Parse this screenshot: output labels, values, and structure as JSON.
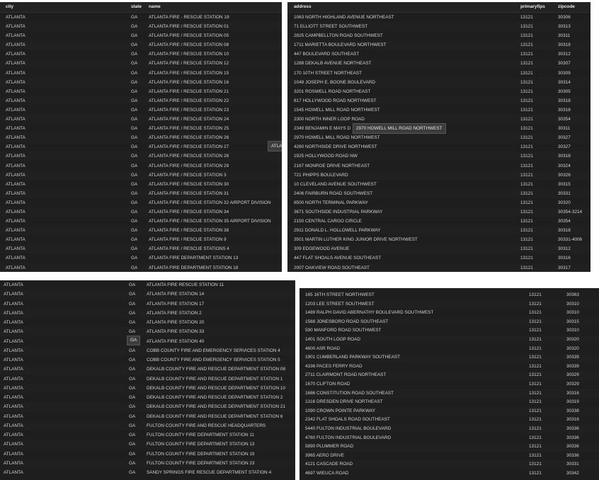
{
  "panel1": {
    "headers": {
      "city": "city",
      "state": "state",
      "name": "name"
    },
    "rows": [
      [
        "ATLANTA",
        "GA",
        "ATLANTA FIRE - RESCUE STATION 19"
      ],
      [
        "ATLANTA",
        "GA",
        "ATLANTA FIRE / RESCUE STATION 01"
      ],
      [
        "ATLANTA",
        "GA",
        "ATLANTA FIRE / RESCUE STATION 05"
      ],
      [
        "ATLANTA",
        "GA",
        "ATLANTA FIRE / RESCUE STATION 08"
      ],
      [
        "ATLANTA",
        "GA",
        "ATLANTA FIRE / RESCUE STATION 10"
      ],
      [
        "ATLANTA",
        "GA",
        "ATLANTA FIRE / RESCUE STATION 12"
      ],
      [
        "ATLANTA",
        "GA",
        "ATLANTA FIRE / RESCUE STATION 15"
      ],
      [
        "ATLANTA",
        "GA",
        "ATLANTA FIRE / RESCUE STATION 16"
      ],
      [
        "ATLANTA",
        "GA",
        "ATLANTA FIRE / RESCUE STATION 21"
      ],
      [
        "ATLANTA",
        "GA",
        "ATLANTA FIRE / RESCUE STATION 22"
      ],
      [
        "ATLANTA",
        "GA",
        "ATLANTA FIRE / RESCUE STATION 23"
      ],
      [
        "ATLANTA",
        "GA",
        "ATLANTA FIRE / RESCUE STATION 24"
      ],
      [
        "ATLANTA",
        "GA",
        "ATLANTA FIRE / RESCUE STATION 25"
      ],
      [
        "ATLANTA",
        "GA",
        "ATLANTA FIRE / RESCUE STATION 26"
      ],
      [
        "ATLANTA",
        "GA",
        "ATLANTA FIRE / RESCUE STATION 27"
      ],
      [
        "ATLANTA",
        "GA",
        "ATLANTA FIRE / RESCUE STATION 28"
      ],
      [
        "ATLANTA",
        "GA",
        "ATLANTA FIRE / RESCUE STATION 29"
      ],
      [
        "ATLANTA",
        "GA",
        "ATLANTA FIRE / RESCUE STATION 3"
      ],
      [
        "ATLANTA",
        "GA",
        "ATLANTA FIRE / RESCUE STATION 30"
      ],
      [
        "ATLANTA",
        "GA",
        "ATLANTA FIRE / RESCUE STATION 31"
      ],
      [
        "ATLANTA",
        "GA",
        "ATLANTA FIRE / RESCUE STATION 32 AIRPORT DIVISION"
      ],
      [
        "ATLANTA",
        "GA",
        "ATLANTA FIRE / RESCUE STATION 34"
      ],
      [
        "ATLANTA",
        "GA",
        "ATLANTA FIRE / RESCUE STATION 35 AIRPORT DIVISION"
      ],
      [
        "ATLANTA",
        "GA",
        "ATLANTA FIRE / RESCUE STATION 38"
      ],
      [
        "ATLANTA",
        "GA",
        "ATLANTA FIRE / RESCUE STATION 9"
      ],
      [
        "ATLANTA",
        "GA",
        "ATLANTA FIRE / RESCUE STATIONS 4"
      ],
      [
        "ATLANTA",
        "GA",
        "ATLANTA FIRE DEPARTMENT STATION 13"
      ],
      [
        "ATLANTA",
        "GA",
        "ATLANTA FIRE DEPARTMENT STATION 18"
      ]
    ],
    "tooltip": "ATLA"
  },
  "panel2": {
    "headers": {
      "address": "address",
      "primaryfips": "primaryfips",
      "zipcode": "zipcode"
    },
    "rows": [
      [
        "1063 NORTH HIGHLAND AVENUE NORTHEAST",
        "13121",
        "30306"
      ],
      [
        "71 ELLIOTT STREET SOUTHWEST",
        "13121",
        "30313"
      ],
      [
        "2825 CAMPBELLTON ROAD SOUTHWEST",
        "13121",
        "30311"
      ],
      [
        "1711 MARIETTA BOULEVARD NORTHWEST",
        "13121",
        "30318"
      ],
      [
        "447 BOULEVARD SOUTHEAST",
        "13121",
        "30312"
      ],
      [
        "1288 DEKALB AVENUE NORTHEAST",
        "13121",
        "30307"
      ],
      [
        "170 10TH STREET NORTHEAST",
        "13121",
        "30309"
      ],
      [
        "1048 JOSEPH E. BOONE BOULEVARD",
        "13121",
        "30314"
      ],
      [
        "3201 ROSWELL ROAD NORTHEAST",
        "13121",
        "30305"
      ],
      [
        "817 HOLLYWOOD ROAD NORTHWEST",
        "13121",
        "30318"
      ],
      [
        "1545 HOWELL MILL ROAD NORTHWEST",
        "13121",
        "30318"
      ],
      [
        "2300 NORTH INNER LOOP ROAD",
        "13121",
        "30354"
      ],
      [
        "2349 BENJAMIN E MAYS D",
        "13121",
        "30311"
      ],
      [
        "2970 HOWELL MILL ROAD NORTHWEST",
        "13121",
        "30327"
      ],
      [
        "4260 NORTHSIDE DRIVE NORTHWEST",
        "13121",
        "30327"
      ],
      [
        "1925 HOLLYWOOD ROAD NW",
        "13121",
        "30318"
      ],
      [
        "2167 MONROE DRIVE NORTHEAST",
        "13121",
        "30324"
      ],
      [
        "721 PHIPPS BOULEVARD",
        "13121",
        "30326"
      ],
      [
        "10 CLEVELAND AVENUE SOUTHWEST",
        "13121",
        "30315"
      ],
      [
        "2406 FAIRBURN ROAD SOUTHWEST",
        "13121",
        "30331"
      ],
      [
        "8500 NORTH TERMINAL PARKWAY",
        "13121",
        "30320"
      ],
      [
        "3671 SOUTHSIDE INDUSTRIAL PARKWAY",
        "13121",
        "30354-3214"
      ],
      [
        "2150 CENTRAL CARGO CIRCLE",
        "13121",
        "30354"
      ],
      [
        "2911 DONALD L. HOLLOWELL PARKWAY",
        "13121",
        "30318"
      ],
      [
        "3501 MARTIN LUTHER KING JUNIOR DRIVE NORTHWEST",
        "13121",
        "30331-4006"
      ],
      [
        "309 EDGEWOOD AVENUE",
        "13121",
        "30312"
      ],
      [
        "447 FLAT SHOALS AVENUE SOUTHEAST",
        "13121",
        "30316"
      ],
      [
        "2007 OAKVIEW ROAD SOUTHEAST",
        "13121",
        "30317"
      ]
    ],
    "tooltip": "2970 HOWELL MILL ROAD NORTHWEST"
  },
  "panel3": {
    "rows": [
      [
        "ATLANTA",
        "GA",
        "ATLANTA FIRE RESCUE STATION 11"
      ],
      [
        "ATLANTA",
        "GA",
        "ATLANTA FIRE STATION 14"
      ],
      [
        "ATLANTA",
        "GA",
        "ATLANTA FIRE STATION 17"
      ],
      [
        "ATLANTA",
        "GA",
        "ATLANTA FIRE STATION 2"
      ],
      [
        "ATLANTA",
        "GA",
        "ATLANTA FIRE STATION 20"
      ],
      [
        "ATLANTA",
        "GA",
        "ATLANTA FIRE STATION 33"
      ],
      [
        "ATLANTA",
        "GA",
        "ATLANTA FIRE STATION 40"
      ],
      [
        "ATLANTA",
        "GA",
        "COBB COUNTY FIRE AND EMERGENCY SERVICES STATION 4"
      ],
      [
        "ATLANTA",
        "GA",
        "COBB COUNTY FIRE AND EMERGENCY SERVICES STATION 5"
      ],
      [
        "ATLANTA",
        "GA",
        "DEKALB COUNTY FIRE AND RESCUE DEPARTMENT STATION 08"
      ],
      [
        "ATLANTA",
        "GA",
        "DEKALB COUNTY FIRE AND RESCUE DEPARTMENT STATION 1"
      ],
      [
        "ATLANTA",
        "GA",
        "DEKALB COUNTY FIRE AND RESCUE DEPARTMENT STATION 10"
      ],
      [
        "ATLANTA",
        "GA",
        "DEKALB COUNTY FIRE AND RESCUE DEPARTMENT STATION 2"
      ],
      [
        "ATLANTA",
        "GA",
        "DEKALB COUNTY FIRE AND RESCUE DEPARTMENT STATION 21"
      ],
      [
        "ATLANTA",
        "GA",
        "DEKALB COUNTY FIRE AND RESCUE DEPARTMENT STATION 6"
      ],
      [
        "ATLANTA",
        "GA",
        "FULTON COUNTY FIRE AND RESCUE HEADQUARTERS"
      ],
      [
        "ATLANTA",
        "GA",
        "FULTON COUNTY FIRE DEPARTMENT STATION 11"
      ],
      [
        "ATLANTA",
        "GA",
        "FULTON COUNTY FIRE DEPARTMENT STATION 13"
      ],
      [
        "ATLANTA",
        "GA",
        "FULTON COUNTY FIRE DEPARTMENT STATION 19"
      ],
      [
        "ATLANTA",
        "GA",
        "FULTON COUNTY FIRE DEPARTMENT STATION 23"
      ],
      [
        "ATLANTA",
        "GA",
        "SANDY SPRINGS FIRE RESCUE DEPARTMENT STATION 4"
      ]
    ],
    "tooltip": "GA"
  },
  "panel4": {
    "rows": [
      [
        "165 16TH STREET NORTHWEST",
        "13121",
        "30363"
      ],
      [
        "1203 LEE STREET SOUTHWEST",
        "13121",
        "30310"
      ],
      [
        "1489 RALPH DAVID ABERNATHY BOULEVARD SOUTHWEST",
        "13121",
        "30310"
      ],
      [
        "1568 JONESBORO ROAD SOUTHEAST",
        "13121",
        "30315"
      ],
      [
        "590 MANFORD ROAD SOUTHWEST",
        "13121",
        "30310"
      ],
      [
        "1401 SOUTH LOOP ROAD",
        "13121",
        "30320"
      ],
      [
        "4600 ASR ROAD",
        "13121",
        "30320"
      ],
      [
        "1901 CUMBERLAND PARKWAY SOUTHEAST",
        "13121",
        "30339"
      ],
      [
        "4336 PACES FERRY ROAD",
        "13121",
        "30339"
      ],
      [
        "2711 CLAIRMONT ROAD NORTHEAST",
        "13121",
        "30329"
      ],
      [
        "1670 CLIFTON ROAD",
        "13121",
        "30329"
      ],
      [
        "1686 CONSTITUTION ROAD SOUTHEAST",
        "13121",
        "30316"
      ],
      [
        "1316 DRESDEN DRIVE NORTHEAST",
        "13121",
        "30319"
      ],
      [
        "1090 CROWN POINTE PARKWAY",
        "13121",
        "30338"
      ],
      [
        "2342 FLAT SHOALS ROAD SOUTHEAST",
        "13121",
        "30316"
      ],
      [
        "5440 FULTON INDUSTRIAL BOULEVARD",
        "13121",
        "30336"
      ],
      [
        "4760 FULTON INDUSTRIAL BOULEVARD",
        "13121",
        "30336"
      ],
      [
        "5890 PLUMMER ROAD",
        "13121",
        "30336"
      ],
      [
        "3965 AERO DRIVE",
        "13121",
        "30336"
      ],
      [
        "4121 CASCADE ROAD",
        "13121",
        "30331"
      ],
      [
        "4697 WIEUCA ROAD",
        "13121",
        "30342"
      ]
    ]
  }
}
